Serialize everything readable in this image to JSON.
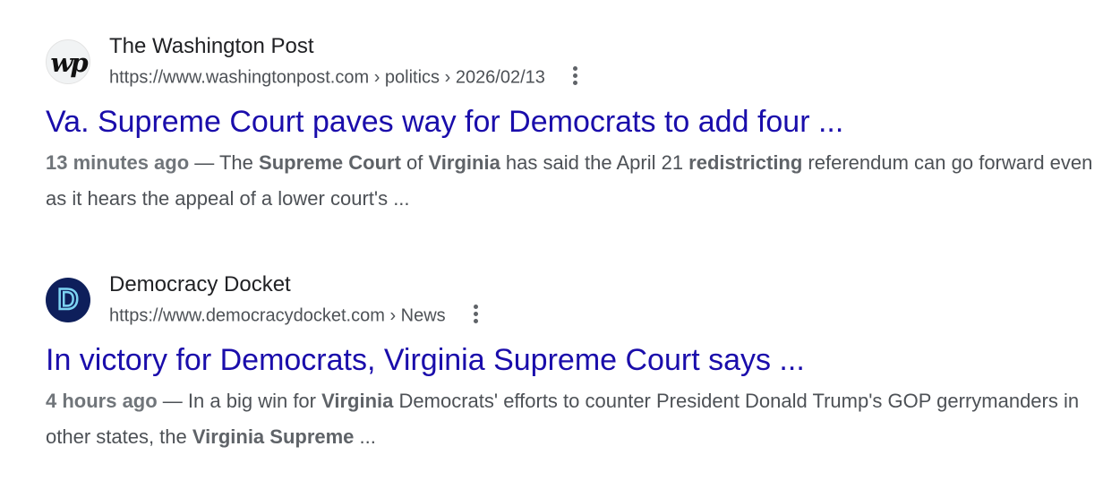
{
  "results": [
    {
      "favicon": {
        "icon": "washington-post-logo",
        "text": "wp"
      },
      "site_name": "The Washington Post",
      "url": "https://www.washingtonpost.com › politics › 2026/02/13",
      "title": "Va. Supreme Court paves way for Democrats to add four ...",
      "snippet": {
        "date": "13 minutes ago",
        "sep": " — ",
        "parts": [
          {
            "text": "The ",
            "em": false
          },
          {
            "text": "Supreme Court",
            "em": true
          },
          {
            "text": " of ",
            "em": false
          },
          {
            "text": "Virginia",
            "em": true
          },
          {
            "text": " has said the April 21 ",
            "em": false
          },
          {
            "text": "redistricting",
            "em": true
          },
          {
            "text": " referendum can go forward even as it hears the appeal of a lower court's ...",
            "em": false
          }
        ]
      }
    },
    {
      "favicon": {
        "icon": "democracy-docket-logo",
        "text": "D"
      },
      "site_name": "Democracy Docket",
      "url": "https://www.democracydocket.com › News",
      "title": "In victory for Democrats, Virginia Supreme Court says ...",
      "snippet": {
        "date": "4 hours ago",
        "sep": " — ",
        "parts": [
          {
            "text": "In a big win for ",
            "em": false
          },
          {
            "text": "Virginia",
            "em": true
          },
          {
            "text": " Democrats' efforts to counter President Donald Trump's GOP gerrymanders in other states, the ",
            "em": false
          },
          {
            "text": "Virginia Supreme",
            "em": true
          },
          {
            "text": " ...",
            "em": false
          }
        ]
      }
    }
  ],
  "colors": {
    "title_link": "#1a0dab",
    "snippet_text": "#4d5156",
    "dd_favicon_bg": "#0e1f5b",
    "dd_favicon_letter": "#7cd3f2"
  }
}
